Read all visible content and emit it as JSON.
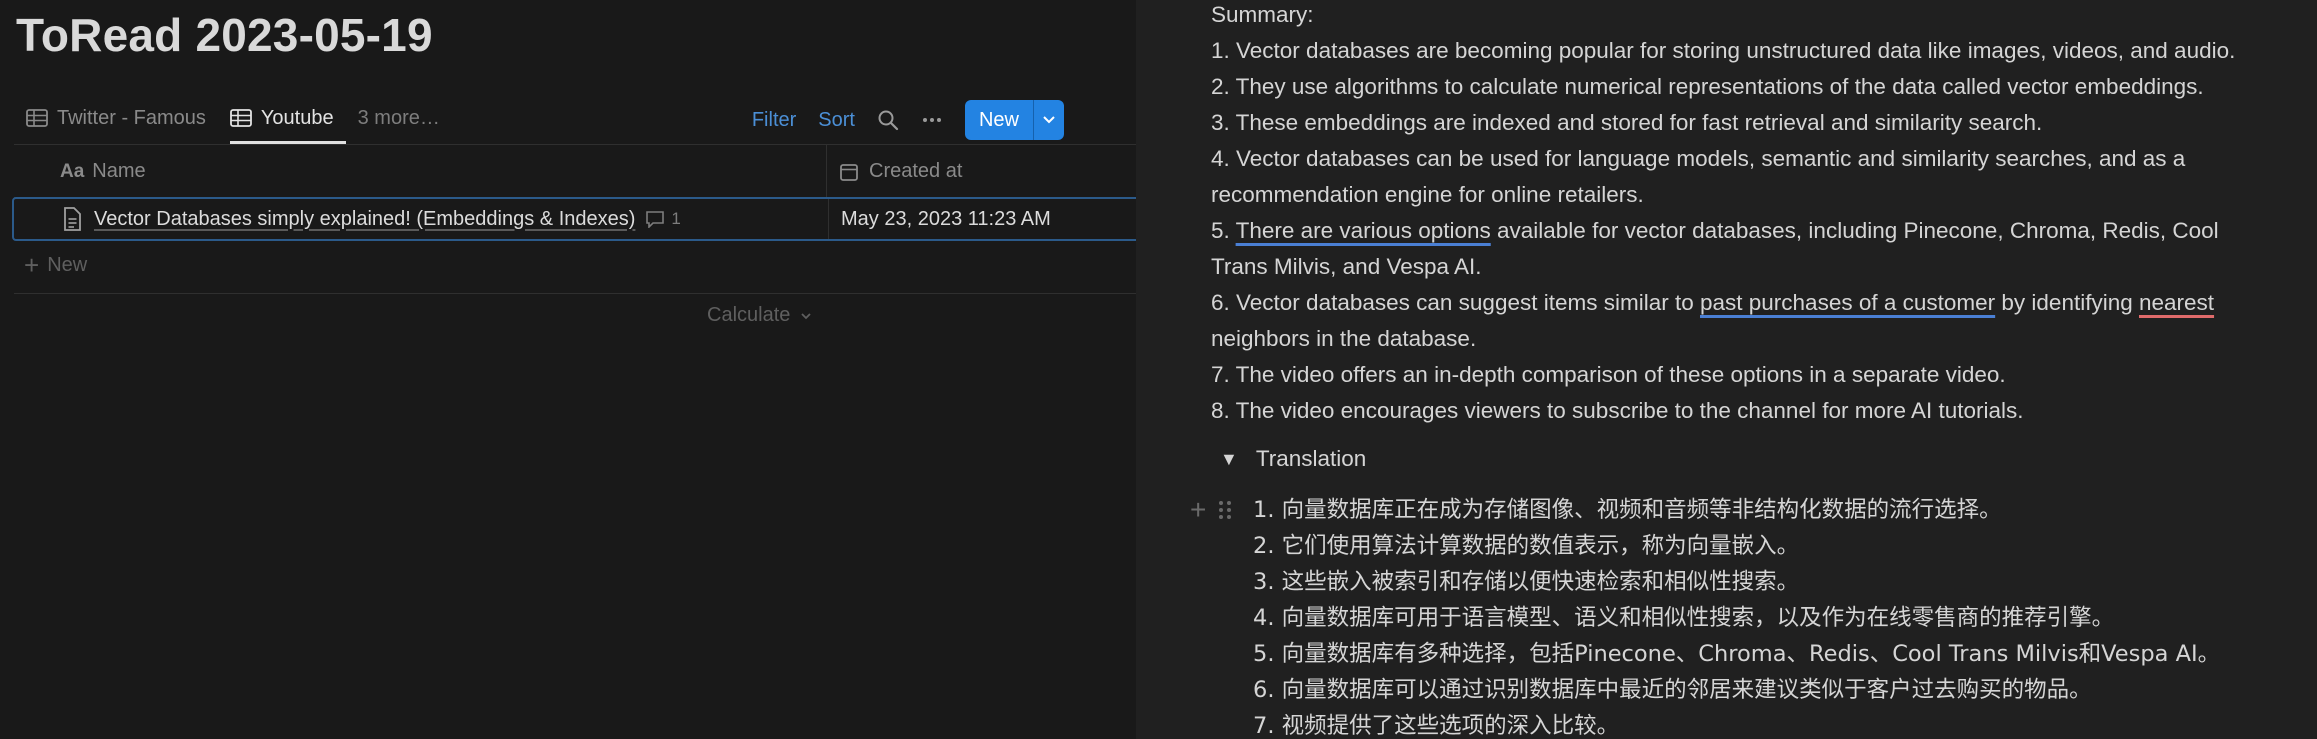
{
  "page": {
    "title": "ToRead 2023-05-19"
  },
  "tabs": [
    {
      "label": "Twitter - Famous",
      "active": false
    },
    {
      "label": "Youtube",
      "active": true
    },
    {
      "label": "3 more…",
      "active": false
    }
  ],
  "toolbar": {
    "filter_label": "Filter",
    "sort_label": "Sort",
    "new_label": "New"
  },
  "table": {
    "columns": [
      {
        "icon": "Aa",
        "label": "Name"
      },
      {
        "icon": "calendar-icon",
        "label": "Created at"
      }
    ],
    "rows": [
      {
        "name": "Vector Databases simply explained! (Embeddings & Indexes)",
        "comments": "1",
        "created_at": "May 23, 2023 11:23 AM"
      }
    ],
    "new_row_label": "New",
    "calculate_label": "Calculate"
  },
  "summary": {
    "heading": "Summary:",
    "lines": [
      "1. Vector databases are becoming popular for storing unstructured data like images, videos, and audio.",
      "2. They use algorithms to calculate numerical representations of the data called vector embeddings.",
      "3. These embeddings are indexed and stored for fast retrieval and similarity search.",
      "4. Vector databases can be used for language models, semantic and similarity searches, and as a",
      "recommendation engine for online retailers.",
      "5. ",
      "There are various options",
      " available for vector databases, including Pinecone, Chroma, Redis, Cool",
      "Trans Milvis, and Vespa AI.",
      "6. Vector databases can suggest items similar to ",
      "past purchases of a customer",
      " by identifying ",
      "nearest",
      "neighbors in the database.",
      "7. The video offers an in-depth comparison of these options in a separate video.",
      "8. The video encourages viewers to subscribe to the channel for more AI tutorials."
    ]
  },
  "translation": {
    "toggle_label": "Translation",
    "lines": [
      "1. 向量数据库正在成为存储图像、视频和音频等非结构化数据的流行选择。",
      "2. 它们使用算法计算数据的数值表示，称为向量嵌入。",
      "3. 这些嵌入被索引和存储以便快速检索和相似性搜索。",
      "4. 向量数据库可用于语言模型、语义和相似性搜索，以及作为在线零售商的推荐引擎。",
      "5. 向量数据库有多种选择，包括Pinecone、Chroma、Redis、Cool Trans Milvis和Vespa AI。",
      "6. 向量数据库可以通过识别数据库中最近的邻居来建议类似于客户过去购买的物品。",
      "7. 视频提供了这些选项的深入比较。"
    ]
  },
  "colors": {
    "accent": "#2383e2",
    "link": "#4b8fd6",
    "underline_blue": "#4a7fd4",
    "underline_red": "#e06b6b"
  }
}
